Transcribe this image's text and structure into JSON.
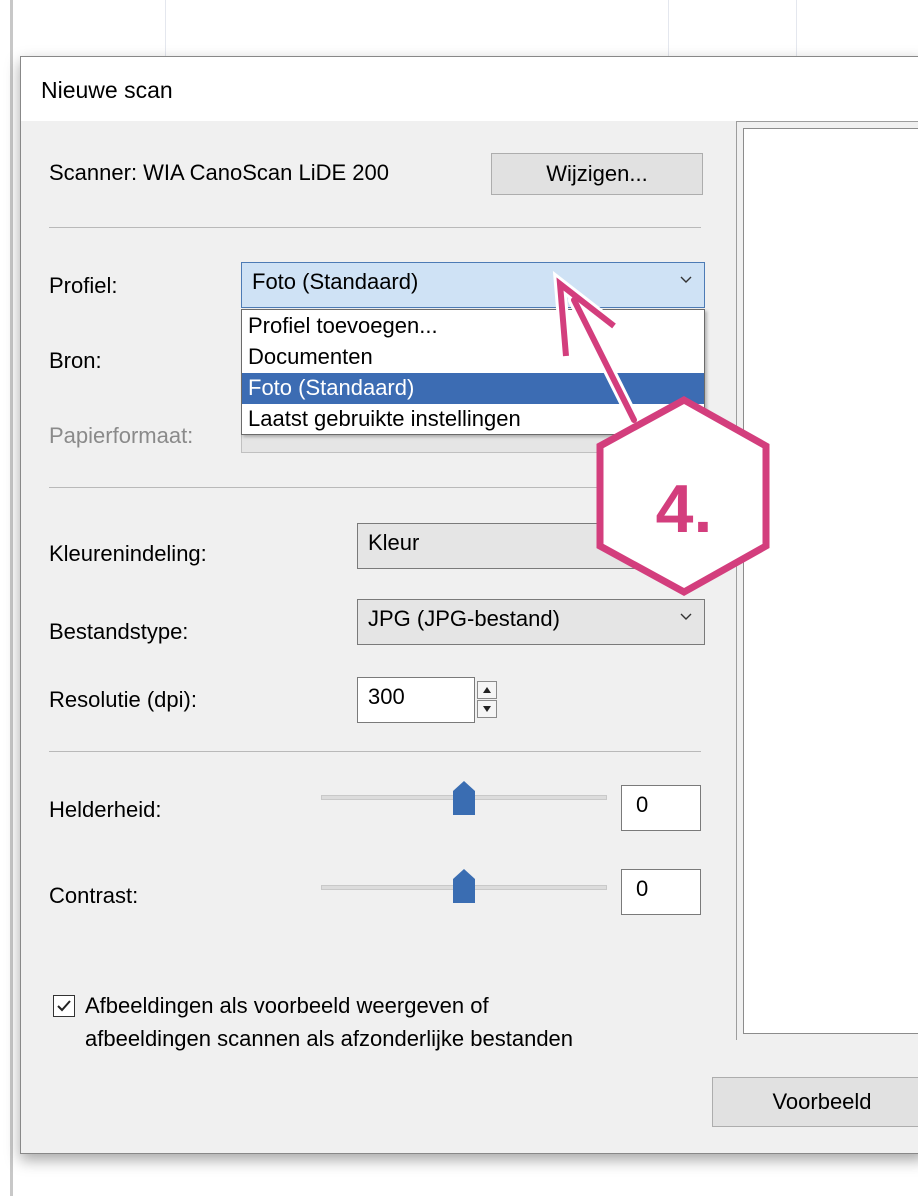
{
  "dialog": {
    "title": "Nieuwe scan",
    "scanner_label": "Scanner: WIA CanoScan LiDE 200",
    "change_button": "Wijzigen...",
    "profile": {
      "label": "Profiel:",
      "value": "Foto (Standaard)",
      "options": [
        "Profiel toevoegen...",
        "Documenten",
        "Foto (Standaard)",
        "Laatst gebruikte instellingen"
      ],
      "selected_index": 2
    },
    "source_label": "Bron:",
    "paper_size_label": "Papierformaat:",
    "color_format": {
      "label": "Kleurenindeling:",
      "value": "Kleur"
    },
    "file_type": {
      "label": "Bestandstype:",
      "value": "JPG (JPG-bestand)"
    },
    "resolution": {
      "label": "Resolutie (dpi):",
      "value": "300"
    },
    "brightness": {
      "label": "Helderheid:",
      "value": "0",
      "slider_position": 0.5
    },
    "contrast": {
      "label": "Contrast:",
      "value": "0",
      "slider_position": 0.5
    },
    "checkbox": {
      "checked": true,
      "line1": "Afbeeldingen als voorbeeld weergeven of",
      "line2": "afbeeldingen scannen als afzonderlijke bestanden"
    },
    "preview_button": "Voorbeeld"
  },
  "annotation": {
    "label": "4.",
    "color": "#d33e7d"
  },
  "colors": {
    "selection": "#3c6cb3",
    "thumb": "#3a6db2",
    "combo_open": "#cfe2f5"
  }
}
